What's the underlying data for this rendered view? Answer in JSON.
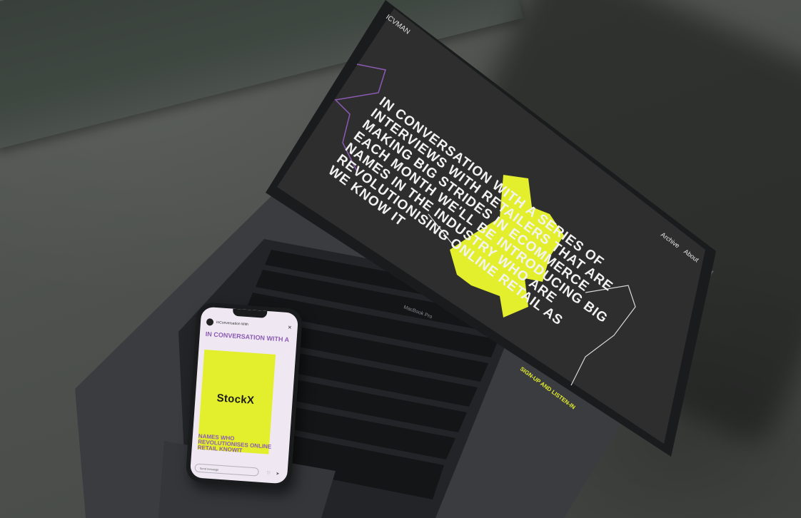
{
  "site": {
    "logo": "ICVMAN",
    "nav": {
      "archive": "Archive",
      "about": "About"
    },
    "headline_lines": [
      "IN CONVERSATION WITH A SERIES OF",
      "INTERVIEWS WITH RETAILERS THAT ARE",
      "MAKING BIG STRIDES IN ECOMMERCE",
      "EACH MONTH WE'LL BE INTRODUCING BIG",
      "NAMES IN THE INDUSTRY WHO ARE",
      "REVOLUTIONISING ONLINE RETAIL AS",
      "WE KNOW IT"
    ],
    "cta": "SIGN-UP AND LISTEN-IN",
    "laptop_model": "MacBook Pro"
  },
  "phone": {
    "header_title": "InConversation With",
    "text_top": "IN CONVERSATION WITH A",
    "brand": "StockX",
    "text_bottom": "NAMES WHO REVOLUTIONISES ONLINE RETAIL KNOWIT",
    "message_placeholder": "Send message"
  },
  "colors": {
    "accent_yellow": "#e3ef2d",
    "screen_bg": "#2e2e2f",
    "text_white": "#f2f2f2",
    "accent_purple": "#8b5bb3"
  }
}
